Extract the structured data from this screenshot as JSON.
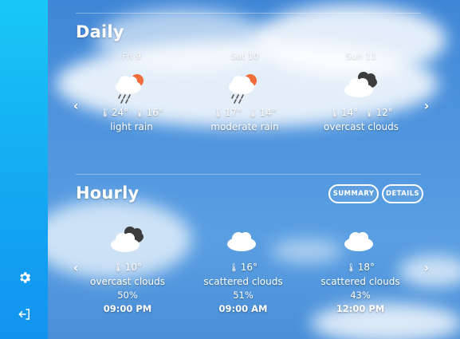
{
  "sidebar": {
    "items": [
      {
        "icon": "gear-icon"
      },
      {
        "icon": "logout-icon"
      }
    ]
  },
  "daily": {
    "title": "Daily",
    "cards": [
      {
        "date": "Fri 9",
        "icon": "cloud-sun-rain-icon",
        "high": "24°",
        "low": "16°",
        "desc": "light rain"
      },
      {
        "date": "Sat 10",
        "icon": "cloud-sun-rain-icon",
        "high": "17°",
        "low": "14°",
        "desc": "moderate rain"
      },
      {
        "date": "Sun 11",
        "icon": "overcast-clouds-icon",
        "high": "14°",
        "low": "12°",
        "desc": "overcast clouds"
      }
    ]
  },
  "hourly": {
    "title": "Hourly",
    "buttons": {
      "summary": "SUMMARY",
      "details": "DETAILS"
    },
    "cards": [
      {
        "icon": "overcast-clouds-icon",
        "temp": "10°",
        "desc": "overcast clouds",
        "pop": "50%",
        "time": "09:00 PM"
      },
      {
        "icon": "scattered-clouds-icon",
        "temp": "16°",
        "desc": "scattered clouds",
        "pop": "51%",
        "time": "09:00 AM"
      },
      {
        "icon": "scattered-clouds-icon",
        "temp": "18°",
        "desc": "scattered clouds",
        "pop": "43%",
        "time": "12:00 PM"
      }
    ]
  },
  "nav": {
    "prev": "‹",
    "next": "›"
  },
  "colors": {
    "sidebar_top": "#19c7f7",
    "sidebar_bottom": "#1193ef",
    "sun": "#f26b3a",
    "cloud_dark": "#4a4a4a"
  }
}
